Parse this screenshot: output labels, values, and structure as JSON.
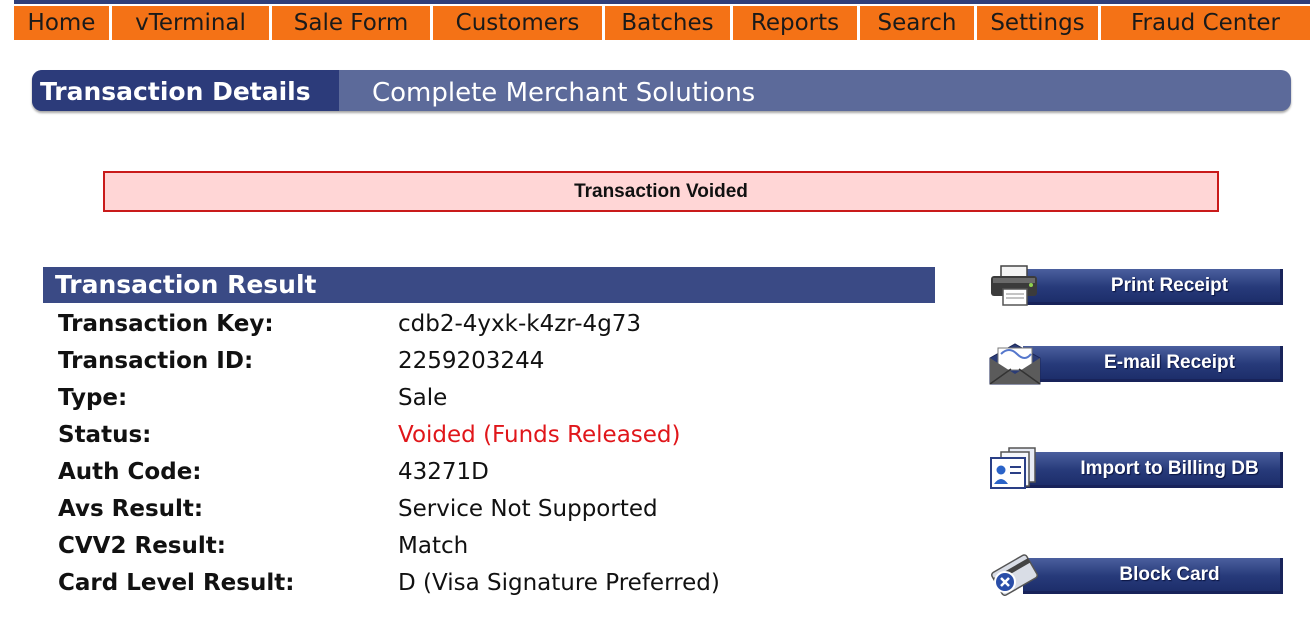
{
  "nav": {
    "items": [
      {
        "label": "Home",
        "width": 98
      },
      {
        "label": "vTerminal",
        "width": 160
      },
      {
        "label": "Sale Form",
        "width": 161
      },
      {
        "label": "Customers",
        "width": 172
      },
      {
        "label": "Batches",
        "width": 128
      },
      {
        "label": "Reports",
        "width": 127
      },
      {
        "label": "Search",
        "width": 117
      },
      {
        "label": "Settings",
        "width": 124
      },
      {
        "label": "Fraud Center",
        "width": 209
      }
    ]
  },
  "banner": {
    "title": "Transaction Details",
    "subtitle": "Complete Merchant Solutions"
  },
  "notice": {
    "text": "Transaction Voided"
  },
  "transaction": {
    "header": "Transaction Result",
    "fields": [
      {
        "label": "Transaction Key:",
        "value": "cdb2-4yxk-k4zr-4g73"
      },
      {
        "label": "Transaction ID:",
        "value": "2259203244"
      },
      {
        "label": "Type:",
        "value": "Sale"
      },
      {
        "label": "Status:",
        "value": "Voided (Funds Released)"
      },
      {
        "label": "Auth Code:",
        "value": "43271D"
      },
      {
        "label": "Avs Result:",
        "value": "Service Not Supported"
      },
      {
        "label": "CVV2 Result:",
        "value": "Match"
      },
      {
        "label": "Card Level Result:",
        "value": "D (Visa Signature Preferred)"
      }
    ]
  },
  "actions": {
    "print": "Print Receipt",
    "email": "E-mail Receipt",
    "import": "Import to Billing DB",
    "block": "Block Card"
  },
  "colors": {
    "nav_bg": "#f47216",
    "banner_dark": "#2c3b7a",
    "banner_light": "#5c6a9a",
    "notice_bg": "#ffd6d6",
    "notice_border": "#c91a1a",
    "status_red": "#e0161a"
  }
}
